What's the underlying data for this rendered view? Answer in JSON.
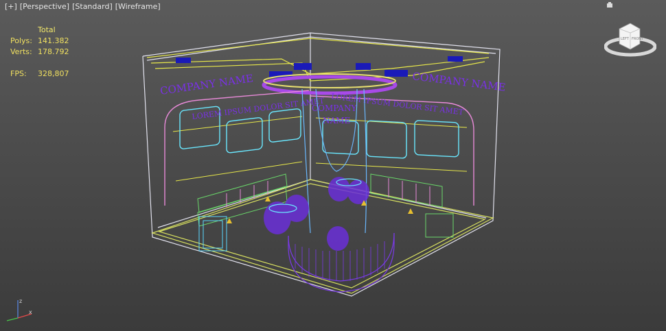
{
  "viewport": {
    "menu": [
      "[+]",
      "[Perspective]",
      "[Standard]",
      "[Wireframe]"
    ]
  },
  "stats": {
    "header": "Total",
    "polys_label": "Polys:",
    "polys_value": "141.382",
    "verts_label": "Verts:",
    "verts_value": "178.792",
    "fps_label": "FPS:",
    "fps_value": "328,807"
  },
  "scene": {
    "wall_text_left": "COMPANY NAME",
    "wall_text_right": "COMPANY NAME",
    "tagline_left": "LOREM IPSUM DOLOR SIT AMET",
    "tagline_right": "LOREM IPSUM DOLOR SIT AMET",
    "center_text_line1": "COMPANY",
    "center_text_line2": "NAME",
    "colors": {
      "floor": "#d8e060",
      "walls": "#e4e4f0",
      "purple": "#6a2fd8",
      "cyan": "#6ae8ff",
      "pink": "#e88ad8",
      "green": "#6ad86a",
      "yellow": "#e8e84a",
      "blue": "#1a1ab8"
    }
  },
  "viewcube": {
    "left_face": "LEFT",
    "front_face": "FRONT"
  },
  "axis": {
    "x": "x",
    "z": "z"
  }
}
